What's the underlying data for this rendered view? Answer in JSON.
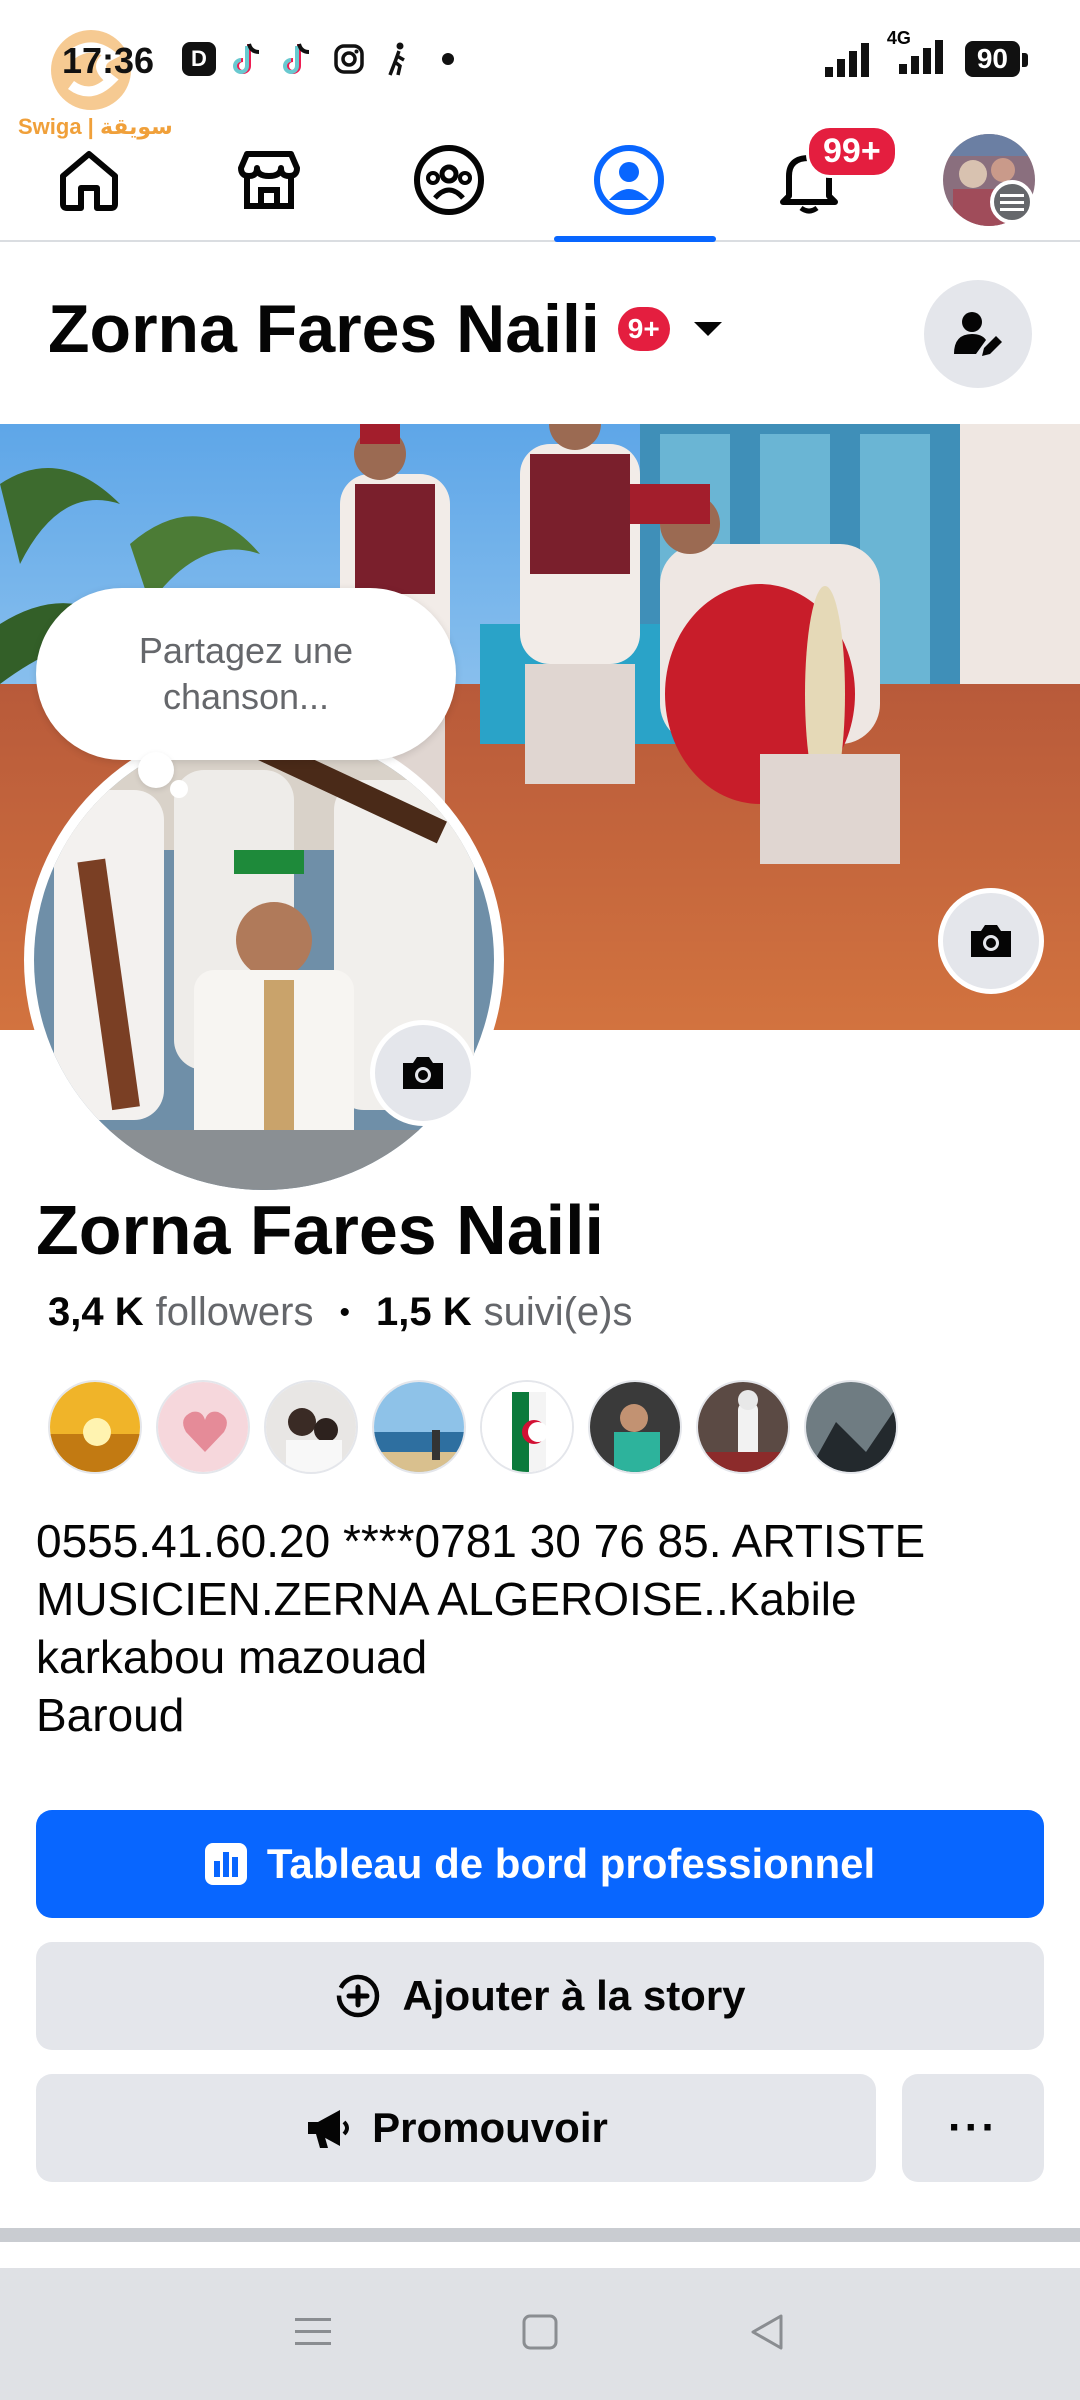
{
  "status_bar": {
    "time": "17:36",
    "network": "4G",
    "battery": "90",
    "app_icons": [
      "d-app-icon",
      "tiktok-icon",
      "tiktok-icon",
      "instagram-icon",
      "walking-icon"
    ]
  },
  "watermark": {
    "text": "Swiga | سويقة"
  },
  "topnav": {
    "items": [
      "home-icon",
      "marketplace-icon",
      "groups-icon",
      "profile-icon",
      "notifications-icon",
      "menu-avatar"
    ],
    "active": "profile-icon",
    "notification_badge": "99+"
  },
  "header": {
    "name": "Zorna Fares Naili",
    "badge": "9+"
  },
  "note": {
    "text": "Partagez une chanson..."
  },
  "profile": {
    "name": "Zorna Fares Naili",
    "followers_count": "3,4 K",
    "followers_label": "followers",
    "following_count": "1,5 K",
    "following_label": "suivi(e)s",
    "separator": "•"
  },
  "bio": "0555.41.60.20 ****0781 30 76 85. ARTISTE MUSICIEN.ZERNA ALGEROISE..Kabile\nkarkabou mazouad\nBaroud",
  "buttons": {
    "dashboard": "Tableau de bord professionnel",
    "add_story": "Ajouter à la story",
    "promote": "Promouvoir",
    "more": "···"
  },
  "colors": {
    "accent": "#0866ff",
    "badge": "#e41e3f",
    "secondary_button": "#e4e6eb",
    "muted_text": "#65676b"
  }
}
